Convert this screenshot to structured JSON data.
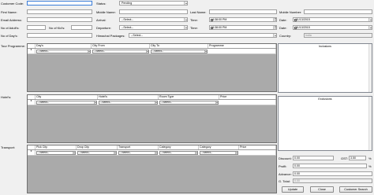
{
  "customer": {
    "code_label": "Customer Code:",
    "code_value": "",
    "first_name_label": "First Name:",
    "first_name_value": "",
    "email_label": "Email Address:",
    "email_value": "",
    "adults_label": "No of Adult's:",
    "adults_value": "",
    "kids_label": "No of Kid's:",
    "kids_value": "",
    "days_label": "No of Day's:",
    "days_value": ""
  },
  "status": {
    "label": "Status:",
    "value": "Pending"
  },
  "middle_name": {
    "label": "Middle Name:",
    "value": ""
  },
  "last_name": {
    "label": "Last Name:",
    "value": ""
  },
  "mobile": {
    "label": "Mobile Number:",
    "value": ""
  },
  "arrival": {
    "label": "Arrival:",
    "value": "--Select--",
    "time_label": "Time:",
    "time_value": "4:38:00 PM",
    "date_label": "Date:",
    "date_value": "11/13/2015"
  },
  "departure": {
    "label": "Departure:",
    "value": "--Select--",
    "time_label": "Time:",
    "time_value": "4:38:00 PM",
    "date_label": "Date:",
    "date_value": "11/13/2015"
  },
  "himachal": {
    "label": "Himachal Packages:",
    "value": "--Select--"
  },
  "country": {
    "label": "Country:",
    "value": "India"
  },
  "tour_programme": {
    "label": "Tour Programme:",
    "columns": [
      "Day's",
      "City From",
      "City To",
      "Programme"
    ],
    "row": [
      "--Select--",
      "--Select--",
      "--Select--",
      ""
    ]
  },
  "hotels": {
    "label": "Hotel's:",
    "columns": [
      "City",
      "Hotel's",
      "Room Type",
      "Price"
    ],
    "row": [
      "--Select--",
      "--Select--",
      "--Select--",
      ""
    ]
  },
  "transport": {
    "label": "Transport:",
    "columns": [
      "Pick City",
      "Drop City",
      "Transport",
      "Category",
      "Category",
      "Price"
    ],
    "row": [
      "--Select--",
      "--Select--",
      "--Select--",
      "--Select--",
      "--Select--",
      ""
    ]
  },
  "row_marker": "*",
  "inclusions": {
    "title": "Inclusions"
  },
  "exclusions": {
    "title": "Exclusions"
  },
  "totals": {
    "discount_label": "Discount:",
    "discount_value": "0.00",
    "gst_label": "GST:",
    "gst_value": "3.50",
    "gst_unit": "%",
    "profit_label": "Profit:",
    "profit_value": "0.00",
    "advance_label": "Advance:",
    "advance_value": "0.00",
    "gtotal_label": "G. Total:",
    "gtotal_value": "0.00"
  },
  "buttons": {
    "update": "Update",
    "close": "Close",
    "customer_search": "Customer Search"
  },
  "icons": {
    "dropdown": "chevron-down-icon",
    "calendar": "calendar-dropdown-icon",
    "spinner": "spinner-icon"
  }
}
